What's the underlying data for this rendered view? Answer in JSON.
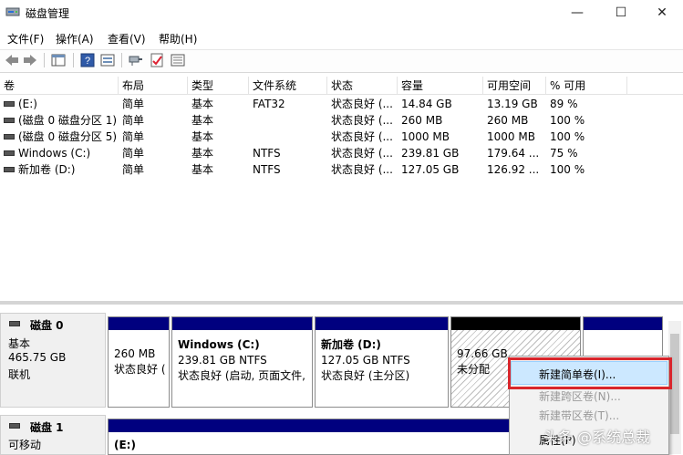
{
  "window": {
    "title": "磁盘管理",
    "minimize_glyph": "—",
    "maximize_glyph": "☐",
    "close_glyph": "✕"
  },
  "menu": [
    {
      "label": "文件(F)"
    },
    {
      "label": "操作(A)"
    },
    {
      "label": "查看(V)"
    },
    {
      "label": "帮助(H)"
    }
  ],
  "toolbar": {
    "icons": [
      "back-arrow-icon",
      "forward-arrow-icon",
      "console-tree-icon",
      "help-icon",
      "properties-icon",
      "connect-icon",
      "checklist-icon",
      "list-view-icon"
    ]
  },
  "volume_table": {
    "columns": [
      "卷",
      "布局",
      "类型",
      "文件系统",
      "状态",
      "容量",
      "可用空间",
      "% 可用"
    ],
    "rows": [
      [
        "(E:)",
        "简单",
        "基本",
        "FAT32",
        "状态良好 (...",
        "14.84 GB",
        "13.19 GB",
        "89 %"
      ],
      [
        "(磁盘 0 磁盘分区 1)",
        "简单",
        "基本",
        "",
        "状态良好 (...",
        "260 MB",
        "260 MB",
        "100 %"
      ],
      [
        "(磁盘 0 磁盘分区 5)",
        "简单",
        "基本",
        "",
        "状态良好 (...",
        "1000 MB",
        "1000 MB",
        "100 %"
      ],
      [
        "Windows (C:)",
        "简单",
        "基本",
        "NTFS",
        "状态良好 (...",
        "239.81 GB",
        "179.64 ...",
        "75 %"
      ],
      [
        "新加卷 (D:)",
        "简单",
        "基本",
        "NTFS",
        "状态良好 (...",
        "127.05 GB",
        "126.92 ...",
        "100 %"
      ]
    ]
  },
  "disks": [
    {
      "name": "磁盘 0",
      "type": "基本",
      "size": "465.75 GB",
      "status": "联机",
      "partitions": [
        {
          "title": "",
          "line1": "260 MB",
          "line2": "状态良好 (",
          "bar": "#00007f"
        },
        {
          "title": "Windows  (C:)",
          "line1": "239.81 GB NTFS",
          "line2": "状态良好 (启动, 页面文件,",
          "bar": "#00007f"
        },
        {
          "title": "新加卷  (D:)",
          "line1": "127.05 GB NTFS",
          "line2": "状态良好 (主分区)",
          "bar": "#00007f"
        },
        {
          "title": "",
          "line1": "97.66 GB",
          "line2": "未分配",
          "bar": "#000000"
        },
        {
          "title": "",
          "line1": "",
          "line2": "",
          "bar": "#00007f"
        }
      ]
    },
    {
      "name": "磁盘 1",
      "type": "可移动",
      "partitions": [
        {
          "title": "(E:)",
          "bar": "#00007f"
        }
      ]
    }
  ],
  "context_menu": {
    "items": [
      {
        "label": "新建简单卷(I)...",
        "enabled": true,
        "highlighted": true
      },
      {
        "label": "新建跨区卷(N)...",
        "enabled": false
      },
      {
        "label": "新建带区卷(T)...",
        "enabled": false
      },
      {
        "label": "属性(P)",
        "enabled": true
      }
    ]
  },
  "watermark": "头条 @系统总裁",
  "colors": {
    "primary_partition_bar": "#00007f",
    "unallocated_bar": "#000000",
    "highlight": "#cce8ff",
    "callout_border": "#d9262c"
  }
}
